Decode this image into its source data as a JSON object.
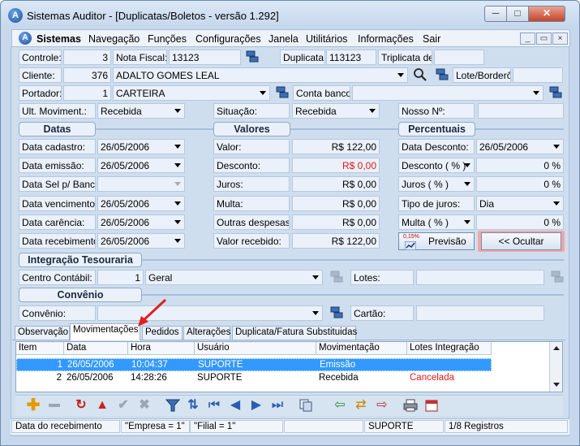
{
  "window": {
    "title": "Sistemas Auditor - [Duplicatas/Boletos - versão 1.292]",
    "min_glyph": "─",
    "max_glyph": "□",
    "close_glyph": "✕"
  },
  "menu": {
    "logo": "A",
    "items": [
      "Sistemas",
      "Navegação",
      "Funções",
      "Configurações",
      "Janela",
      "Utilitários",
      "Informações",
      "Sair"
    ],
    "mdi_min": "_",
    "mdi_restore": "▭",
    "mdi_close": "×"
  },
  "row1": {
    "controle_label": "Controle:",
    "controle_value": "3",
    "nota_label": "Nota Fiscal:",
    "nota_value": "13123",
    "duplicata_label": "Duplicata:",
    "duplicata_value": "113123",
    "triplicata_label": "Triplicata de:",
    "triplicata_value": ""
  },
  "row2": {
    "cliente_label": "Cliente:",
    "cliente_code": "376",
    "cliente_name": "ADALTO GOMES LEAL",
    "lote_label": "Lote/Borderô:",
    "lote_value": ""
  },
  "row3": {
    "portador_label": "Portador:",
    "portador_code": "1",
    "portador_name": "CARTEIRA",
    "conta_label": "Conta banco:",
    "conta_value": ""
  },
  "row4": {
    "ult_label": "Ult. Moviment.:",
    "ult_value": "Recebida",
    "situacao_label": "Situação:",
    "situacao_value": "Recebida",
    "nosso_label": "Nosso Nº:",
    "nosso_value": ""
  },
  "sections": {
    "datas": "Datas",
    "valores": "Valores",
    "percentuais": "Percentuais",
    "tesouraria": "Integração Tesouraria",
    "convenio": "Convênio"
  },
  "datas": [
    {
      "label": "Data cadastro:",
      "value": "26/05/2006"
    },
    {
      "label": "Data emissão:",
      "value": "26/05/2006"
    },
    {
      "label": "Data Sel p/ Banco:",
      "value": ""
    },
    {
      "label": "Data vencimento:",
      "value": "26/05/2006"
    },
    {
      "label": "Data carência:",
      "value": "26/05/2006"
    },
    {
      "label": "Data recebimento:",
      "value": "26/05/2006"
    }
  ],
  "valores": [
    {
      "label": "Valor:",
      "value": "R$ 122,00"
    },
    {
      "label": "Desconto:",
      "value": "R$ 0,00"
    },
    {
      "label": "Juros:",
      "value": "R$ 0,00"
    },
    {
      "label": "Multa:",
      "value": "R$ 0,00"
    },
    {
      "label": "Outras despesas:",
      "value": "R$ 0,00"
    },
    {
      "label": "Valor recebido:",
      "value": "R$ 122,00"
    }
  ],
  "percentuais": {
    "data_desconto_label": "Data Desconto:",
    "data_desconto_value": "26/05/2006",
    "desconto_label": "Desconto ( % )",
    "desconto_value": "0 %",
    "juros_label": "Juros ( % )",
    "juros_value": "0 %",
    "tipo_juros_label": "Tipo de juros:",
    "tipo_juros_value": "Dia",
    "multa_label": "Multa ( % )",
    "multa_value": "0 %"
  },
  "buttons": {
    "previsao": "Previsão",
    "previsao_badge": "0,15%",
    "ocultar": "<< Ocultar"
  },
  "tesouraria": {
    "centro_label": "Centro Contábil:",
    "centro_code": "1",
    "centro_name": "Geral",
    "lotes_label": "Lotes:",
    "lotes_value": ""
  },
  "convenio": {
    "convenio_label": "Convênio:",
    "convenio_value": "",
    "cartao_label": "Cartão:",
    "cartao_value": ""
  },
  "tabs": [
    "Observação",
    "Movimentações",
    "Pedidos",
    "Alterações",
    "Duplicata/Fatura Substituidas"
  ],
  "grid": {
    "columns": [
      "Item",
      "Data",
      "Hora",
      "Usuário",
      "Movimentação",
      "Lotes Integração"
    ],
    "rows": [
      {
        "item": "1",
        "data": "26/05/2006",
        "hora": "10:04:37",
        "usuario": "SUPORTE",
        "mov": "Emissão",
        "lotes": ""
      },
      {
        "item": "2",
        "data": "26/05/2006",
        "hora": "14:28:26",
        "usuario": "SUPORTE",
        "mov": "Recebida",
        "lotes": "Cancelada"
      }
    ]
  },
  "statusbar": {
    "field": "Data do recebimento",
    "empresa": "\"Empresa = 1\"",
    "filial": "\"Filial = 1\"",
    "blank1": "",
    "blank2": "",
    "user": "SUPORTE",
    "records": "1/8 Registros"
  },
  "colors": {
    "accent_red": "#e01a1a",
    "selection_blue": "#3399ff",
    "window_bg": "#c7d8ec"
  }
}
